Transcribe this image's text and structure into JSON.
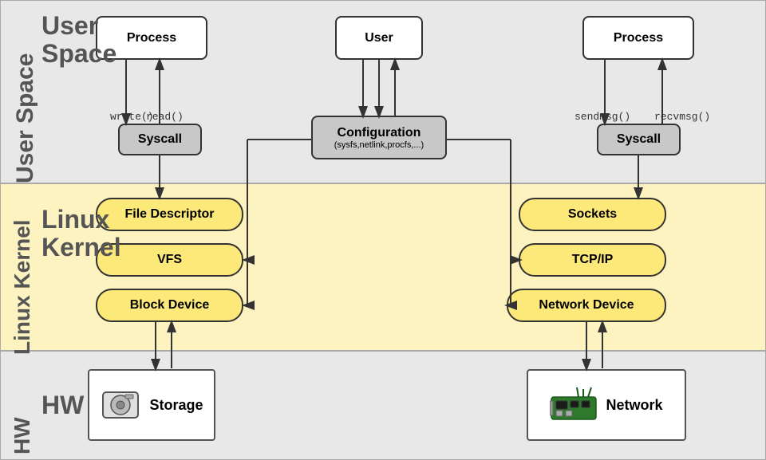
{
  "sections": {
    "user_space": {
      "label": "User Space"
    },
    "kernel": {
      "label": "Linux\nKernel"
    },
    "hw": {
      "label": "HW"
    }
  },
  "boxes": {
    "process_left": {
      "label": "Process"
    },
    "user_center": {
      "label": "User"
    },
    "process_right": {
      "label": "Process"
    },
    "syscall_left": {
      "label": "Syscall"
    },
    "configuration": {
      "label": "Configuration",
      "sub": "(sysfs,netlink,procfs,...)"
    },
    "syscall_right": {
      "label": "Syscall"
    },
    "file_descriptor": {
      "label": "File Descriptor"
    },
    "vfs": {
      "label": "VFS"
    },
    "block_device": {
      "label": "Block Device"
    },
    "sockets": {
      "label": "Sockets"
    },
    "tcp_ip": {
      "label": "TCP/IP"
    },
    "network_device": {
      "label": "Network Device"
    },
    "storage": {
      "label": "Storage"
    },
    "network": {
      "label": "Network"
    }
  },
  "arrows": {
    "write_label": "write()",
    "read_label": "read()",
    "sendmsg_label": "sendmsg()",
    "recvmsg_label": "recvmsg()"
  },
  "colors": {
    "user_space_bg": "#e8e8e8",
    "kernel_bg": "#fdf3c0",
    "hw_bg": "#e8e8e8",
    "box_yellow": "#fde97a",
    "box_gray": "#c8c8c8",
    "border": "#333"
  }
}
